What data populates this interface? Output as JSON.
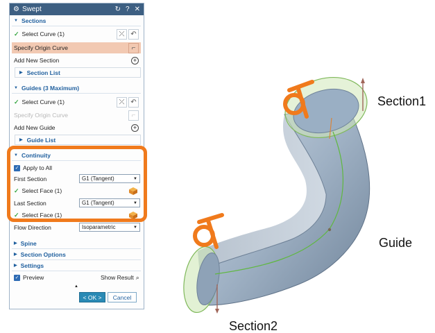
{
  "dialog": {
    "title": "Swept",
    "title_icons": [
      "reset-icon",
      "help-icon",
      "close-icon"
    ],
    "help_glyph": "?",
    "close_glyph": "✕",
    "reset_glyph": "↻"
  },
  "sections": {
    "header": "Sections",
    "select_curve": "Select Curve (1)",
    "specify_origin": "Specify Origin Curve",
    "add_new": "Add New Section",
    "list": "Section List"
  },
  "guides": {
    "header": "Guides (3 Maximum)",
    "select_curve": "Select Curve (1)",
    "specify_origin": "Specify Origin Curve",
    "add_new": "Add New Guide",
    "list": "Guide List"
  },
  "continuity": {
    "header": "Continuity",
    "apply_all": "Apply to All",
    "first_label": "First Section",
    "first_value": "G1 (Tangent)",
    "first_face": "Select Face (1)",
    "last_label": "Last Section",
    "last_value": "G1 (Tangent)",
    "last_face": "Select Face (1)"
  },
  "flow": {
    "label": "Flow Direction",
    "value": "Isoparametric"
  },
  "collapsed": {
    "spine": "Spine",
    "section_options": "Section Options",
    "settings": "Settings"
  },
  "footer": {
    "preview": "Preview",
    "show_result": "Show Result",
    "ok": "< OK >",
    "cancel": "Cancel"
  },
  "labels": {
    "section1": "Section1",
    "section2": "Section2",
    "guide": "Guide"
  },
  "colors": {
    "accent": "#1f5f9e",
    "highlight_row": "#f2c9b2",
    "callout": "#f07a1c",
    "surface": "#9fb2c6",
    "check": "#3aa845"
  }
}
